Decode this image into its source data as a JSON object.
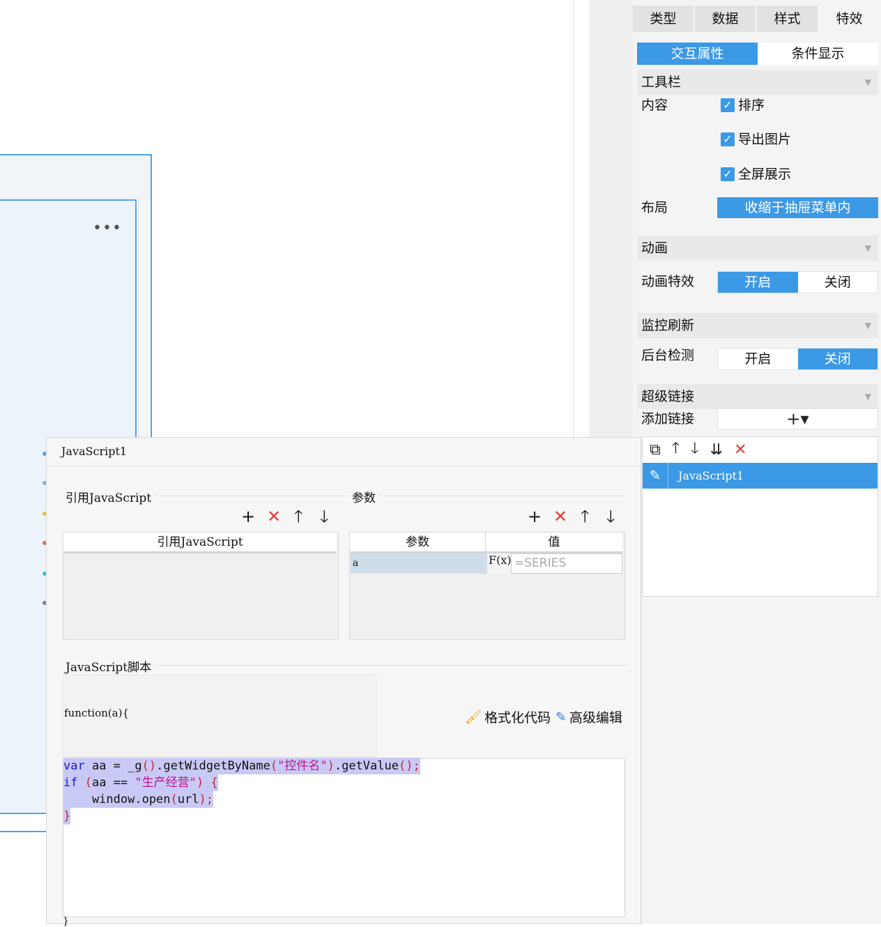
{
  "panel": {
    "tabs": [
      "类型",
      "数据",
      "样式",
      "特效"
    ],
    "subtabs": [
      "交互属性",
      "条件显示"
    ],
    "toolbar_section": "工具栏",
    "content_label": "内容",
    "checkboxes": [
      "排序",
      "导出图片",
      "全屏展示"
    ],
    "layout_label": "布局",
    "layout_value": "收缩于抽屉菜单内",
    "animation_section": "动画",
    "animation_label": "动画特效",
    "animation_on": "开启",
    "animation_off": "关闭",
    "monitor_section": "监控刷新",
    "monitor_label": "后台检测",
    "monitor_on": "开启",
    "monitor_off": "关闭",
    "hyperlink_section": "超级链接",
    "add_link_label": "添加链接",
    "add_link_button": "+▾",
    "link_items": [
      "JavaScript1"
    ]
  },
  "dialog": {
    "title": "JavaScript1",
    "ref_group": "引用JavaScript",
    "ref_column": "引用JavaScript",
    "param_group": "参数",
    "param_columns": [
      "参数",
      "值"
    ],
    "param_rows": [
      {
        "name": "a",
        "value_placeholder": "=SERIES"
      }
    ],
    "fx_label": "F(x)",
    "script_group": "JavaScript脚本",
    "function_signature": "function(a){",
    "format_button": "格式化代码",
    "advanced_button": "高级编辑",
    "code": {
      "line1": {
        "kw": "var",
        "a": " aa = _g",
        "p1": "()",
        "b": ".getWidgetByName",
        "p2": "(",
        "s": "\"控件名\"",
        "p3": ")",
        "c": ".getValue",
        "p4": "();"
      },
      "line2": {
        "kw": "if",
        "p1": " (",
        "a": "aa == ",
        "s": "\"生产经营\"",
        "p2": ") {"
      },
      "line3": {
        "a": "    window.open",
        "p1": "(",
        "b": "url",
        "p2": ");"
      },
      "line4": {
        "p1": "}"
      }
    },
    "closing": "}"
  },
  "canvas": {
    "more_icon": "•••"
  }
}
